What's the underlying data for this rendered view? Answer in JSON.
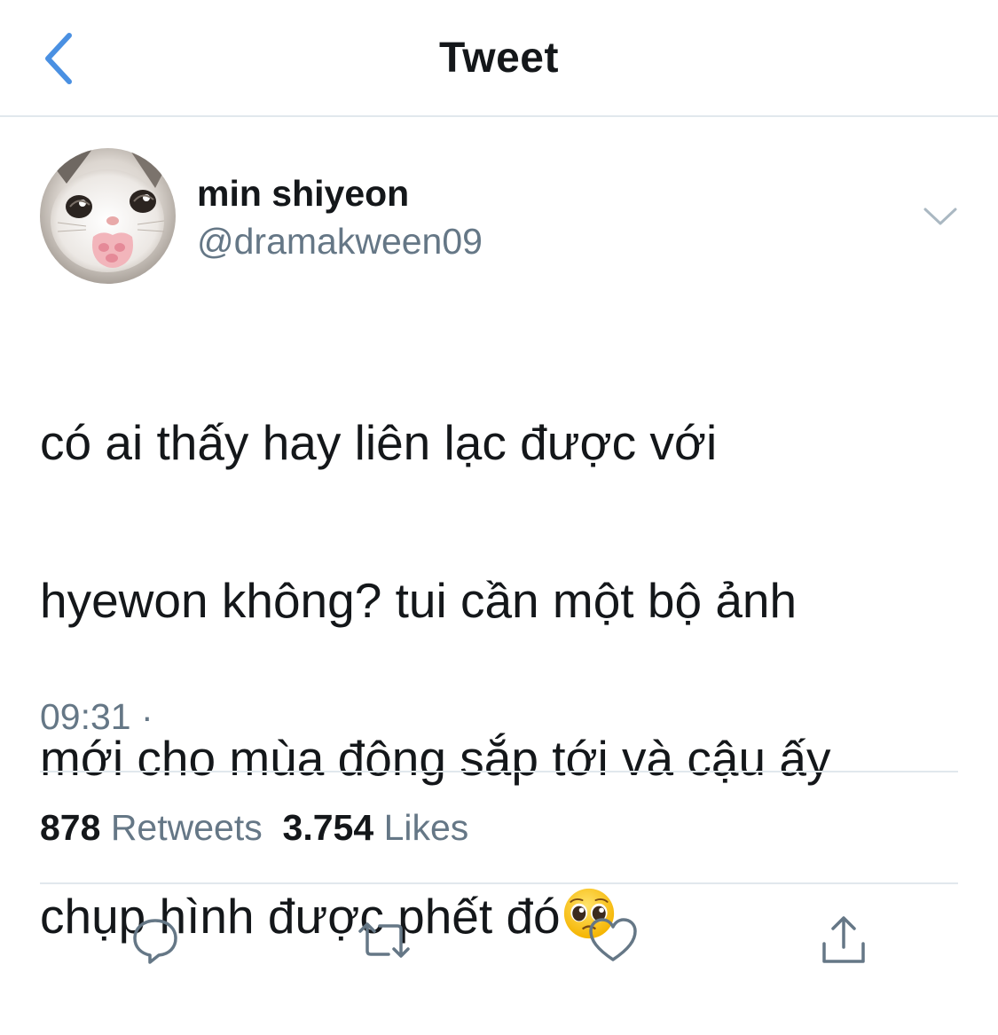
{
  "nav": {
    "title": "Tweet",
    "back_icon": "chevron-left-icon",
    "accent_color": "#4a90e2"
  },
  "author": {
    "display_name": "min shiyeon",
    "handle": "@dramakween09",
    "avatar": "cat-avatar",
    "menu_icon": "chevron-down-icon"
  },
  "tweet": {
    "lines": [
      "có ai thấy hay liên lạc được với",
      "hyewon không? tui cần một bộ ảnh",
      "mới cho mùa đông sắp tới và cậu ấy",
      "chụp hình được phết đó"
    ],
    "emoji": "pleading-face-emoji",
    "time": "09:31",
    "separator": "·"
  },
  "stats": {
    "retweets_count": "878",
    "retweets_label": "Retweets",
    "likes_count": "3.754",
    "likes_label": "Likes"
  },
  "actions": [
    {
      "icon": "reply-icon"
    },
    {
      "icon": "retweet-icon"
    },
    {
      "icon": "like-icon"
    },
    {
      "icon": "share-icon"
    }
  ],
  "colors": {
    "text": "#14171a",
    "secondary": "#657786",
    "divider": "#e1e8ed"
  }
}
